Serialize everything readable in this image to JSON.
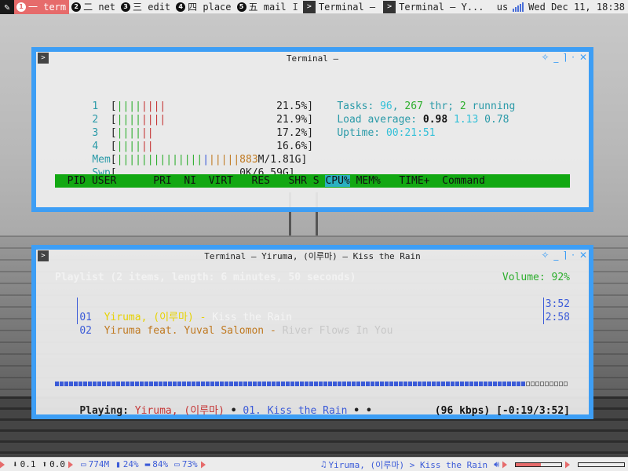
{
  "topbar": {
    "launcher_icon": "terminal-launcher-icon",
    "tags": [
      {
        "num": "1",
        "label": "一 term",
        "active": true
      },
      {
        "num": "2",
        "label": "二 net",
        "active": false
      },
      {
        "num": "3",
        "label": "三 edit",
        "active": false
      },
      {
        "num": "4",
        "label": "四 place",
        "active": false
      },
      {
        "num": "5",
        "label": "五 mail",
        "active": false
      }
    ],
    "separator": "I",
    "tasks": [
      {
        "label": "Terminal –"
      },
      {
        "label": "Terminal – Y..."
      }
    ],
    "keyboard_layout": "us",
    "clock": "Wed Dec 11, 18:38"
  },
  "htop": {
    "title": "Terminal –",
    "cpus": [
      {
        "id": "1",
        "percent": "21.5%"
      },
      {
        "id": "2",
        "percent": "21.9%"
      },
      {
        "id": "3",
        "percent": "17.2%"
      },
      {
        "id": "4",
        "percent": "16.6%"
      }
    ],
    "mem_label": "Mem",
    "mem_used": "883",
    "mem_total": "M/1.81G",
    "swp_label": "Swp",
    "swp_value": "0K/6.59G",
    "tasks_label": "Tasks:",
    "tasks_count": "96",
    "threads": "267",
    "threads_label": "thr;",
    "running": "2",
    "running_label": "running",
    "load_label": "Load average:",
    "load_1": "0.98",
    "load_5": "1.13",
    "load_15": "0.78",
    "uptime_label": "Uptime:",
    "uptime_value": "00:21:51",
    "columns": {
      "pid": "PID",
      "user": "USER",
      "pri": "PRI",
      "ni": "NI",
      "virt": "VIRT",
      "res": "RES",
      "shr": "SHR",
      "s": "S",
      "cpu": "CPU%",
      "mem": "MEM%",
      "time": "TIME+",
      "command": "Command"
    }
  },
  "ncmpcpp": {
    "title": "Terminal – Yiruma, (이루마) – Kiss the Rain",
    "playlist_header": "Playlist (2 items, length: 6 minutes, 50 seconds)",
    "volume": "Volume: 92%",
    "tracks": [
      {
        "num": "01",
        "artist": "Yiruma, (이루마)",
        "sep": "-",
        "title": "Kiss the Rain",
        "length": "3:52"
      },
      {
        "num": "02",
        "artist": "Yiruma feat. Yuval Salomon",
        "sep": "-",
        "title": "River Flows In You",
        "length": "2:58"
      }
    ],
    "progress_fraction": 0.083,
    "playing_label": "Playing:",
    "playing_artist": "Yiruma, (이루마)",
    "playing_bullet": "•",
    "playing_track": "01. Kiss the Rain",
    "playing_tail": "• •",
    "bitrate": "(96 kbps)",
    "time": "[-0:19/3:52]"
  },
  "bottombar": {
    "download": "0.1",
    "upload": "0.0",
    "mem": "774M",
    "battery": "24%",
    "disk": "84%",
    "volume_pct": "73%",
    "now_playing": "Yiruma, (이루마) > Kiss the Rain",
    "volume_level": 0.55,
    "brightness_level": 0.0
  },
  "colors": {
    "accent": "#3d9ef5",
    "tag_active": "#e66b6b",
    "htop_header": "#12a812"
  }
}
